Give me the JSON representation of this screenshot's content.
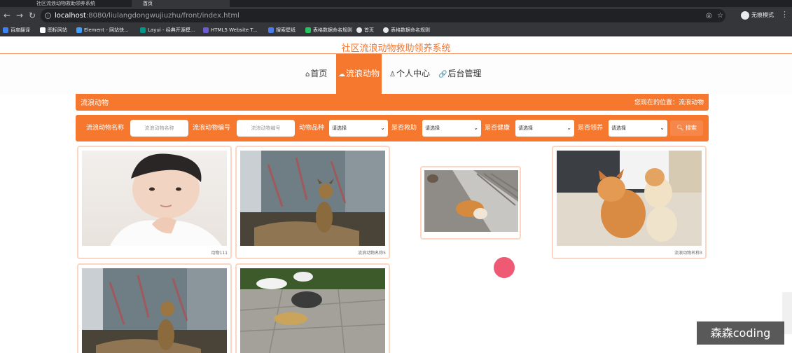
{
  "browser": {
    "tabs": [
      {
        "label": "社区流浪动物救助领养系统"
      },
      {
        "label": "首页"
      }
    ],
    "url_host": "localhost",
    "url_path": ":8080/liulangdongwujiuzhu/front/index.html",
    "profile_label": "无痕模式",
    "bookmarks": [
      {
        "label": "百度翻译",
        "color": "#3b82f6"
      },
      {
        "label": "图标网站",
        "color": "#ffffff"
      },
      {
        "label": "Element - 网站快...",
        "color": "#409eff"
      },
      {
        "label": "Layui - 经典开源模...",
        "color": "#009688"
      },
      {
        "label": "HTML5 Website T...",
        "color": "#6d5bd0"
      },
      {
        "label": "搜索壁纸",
        "color": "#4b7bec"
      },
      {
        "label": "表格数据命名规则",
        "color": "#22c55e"
      },
      {
        "label": "首页",
        "color": "#e5e7eb"
      },
      {
        "label": "表格数据命名规则",
        "color": "#e5e7eb"
      }
    ]
  },
  "site": {
    "title": "社区流浪动物救助领养系统",
    "nav": [
      {
        "label": "首页",
        "icon": "home-icon",
        "glyph": "⌂"
      },
      {
        "label": "流浪动物",
        "icon": "cloud-icon",
        "glyph": "☁"
      },
      {
        "label": "个人中心",
        "icon": "user-icon",
        "glyph": "♙"
      },
      {
        "label": "后台管理",
        "icon": "link-icon",
        "glyph": "🔗"
      }
    ],
    "accent": "#f6772e"
  },
  "breadcrumb": {
    "section": "流浪动物",
    "location": "您现在的位置：流浪动物"
  },
  "filters": {
    "name_label": "流浪动物名称",
    "name_placeholder": "流浪动物名称",
    "code_label": "流浪动物编号",
    "code_placeholder": "流浪动物编号",
    "breed_label": "动物品种",
    "rescued_label": "是否救助",
    "healthy_label": "是否健康",
    "adopted_label": "是否领养",
    "select_default": "请选择",
    "search_label": "搜索"
  },
  "cards": [
    {
      "caption": "动物111",
      "subject": "portrait"
    },
    {
      "caption": "流浪动物名称5",
      "subject": "dog"
    },
    {
      "caption": "",
      "subject": "corgi"
    },
    {
      "caption": "流浪动物名称3",
      "subject": "cats"
    },
    {
      "caption": "",
      "subject": "dog"
    },
    {
      "caption": "",
      "subject": "cats-eating"
    }
  ],
  "watermark": "森森coding"
}
